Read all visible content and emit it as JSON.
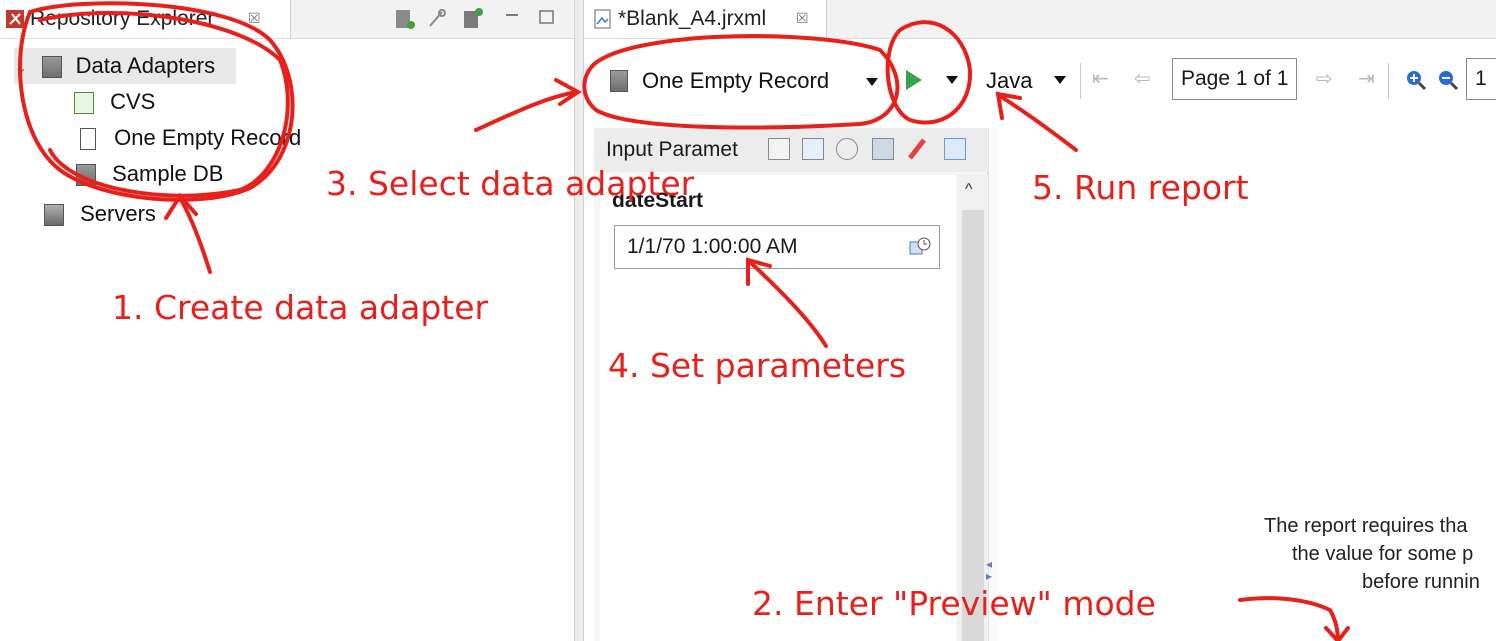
{
  "left_panel": {
    "tab_title": "Repository Explorer",
    "tab_close": "☒",
    "tree": [
      {
        "label": "Data Adapters",
        "icon": "database-icon",
        "expanded": true
      },
      {
        "label": "CVS",
        "icon": "csv-adapter-icon"
      },
      {
        "label": "One Empty Record",
        "icon": "empty-record-icon"
      },
      {
        "label": "Sample DB",
        "icon": "database-icon"
      },
      {
        "label": "Servers",
        "icon": "server-icon"
      }
    ],
    "toolbar_icons": [
      "new-adapter-icon",
      "link-icon",
      "import-icon",
      "minimize-icon",
      "maximize-icon"
    ]
  },
  "editor": {
    "tab_title": "*Blank_A4.jrxml",
    "tab_close": "☒",
    "toolbar": {
      "adapter_label": "One Empty Record",
      "language_label": "Java",
      "page_label": "Page 1 of 1",
      "zoom_partial": "1"
    },
    "input_params": {
      "header": "Input Paramet",
      "param_name": "dateStart",
      "param_value": "1/1/70 1:00:00 AM"
    },
    "message": {
      "line1": "The report requires tha",
      "line2": "the value for some p",
      "line3": "before runnin"
    }
  },
  "annotations": {
    "step1": "1. Create data adapter",
    "step2": "2. Enter \"Preview\" mode",
    "step3": "3. Select data adapter",
    "step4": "4. Set parameters",
    "step5": "5. Run report",
    "color": "#e8201c"
  }
}
